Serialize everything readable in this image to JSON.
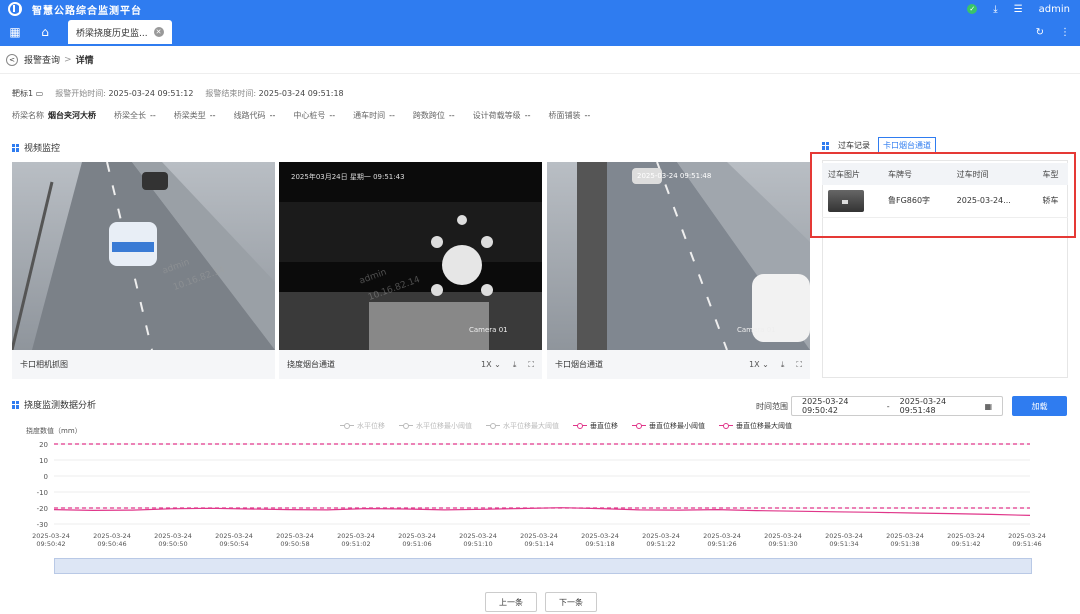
{
  "header": {
    "app_title": "智慧公路综合监测平台",
    "user": "admin"
  },
  "tabs": [
    {
      "label": "桥梁挠度历史监..."
    }
  ],
  "breadcrumb": {
    "parent": "报警查询",
    "sep": ">",
    "current": "详情"
  },
  "alarm": {
    "title": "靶标1",
    "start_label": "报警开始时间:",
    "start_value": "2025-03-24 09:51:12",
    "end_label": "报警结束时间:",
    "end_value": "2025-03-24 09:51:18"
  },
  "bridge_info": [
    {
      "label": "桥梁名称",
      "value": "烟台夹河大桥",
      "bold": true
    },
    {
      "label": "桥梁全长",
      "value": "--"
    },
    {
      "label": "桥梁类型",
      "value": "--"
    },
    {
      "label": "线路代码",
      "value": "--"
    },
    {
      "label": "中心桩号",
      "value": "--"
    },
    {
      "label": "通车时间",
      "value": "--"
    },
    {
      "label": "跨数跨位",
      "value": "--"
    },
    {
      "label": "设计荷载等级",
      "value": "--"
    },
    {
      "label": "桥面铺装",
      "value": "--"
    }
  ],
  "video_section": {
    "title": "视频监控"
  },
  "cameras": [
    {
      "label": "卡口相机抓图",
      "controls": false
    },
    {
      "label": "挠度烟台通道",
      "controls": true,
      "speed": "1X",
      "osd_time": "2025年03月24日 星期一 09:51:43",
      "osd_cam": "Camera 01"
    },
    {
      "label": "卡口烟台通道",
      "controls": true,
      "speed": "1X",
      "osd_time": "2025-03-24 09:51:48",
      "osd_cam": "Camera 01"
    }
  ],
  "records": {
    "tabs": [
      "过车记录",
      "卡口烟台通道"
    ],
    "active_tab": 1,
    "columns": [
      "过车图片",
      "车牌号",
      "过车时间",
      "车型"
    ],
    "rows": [
      {
        "plate": "鲁FG860字",
        "time": "2025-03-24...",
        "type": "轿车"
      }
    ]
  },
  "analysis": {
    "title": "挠度监测数据分析",
    "time_range_label": "时间范围",
    "time_start": "2025-03-24 09:50:42",
    "time_sep": "-",
    "time_end": "2025-03-24 09:51:48",
    "load_button": "加载"
  },
  "watermark": {
    "name": "admin",
    "ip": "10.16.82.14"
  },
  "chart_data": {
    "type": "line",
    "ylabel": "挠度数值（mm）",
    "ylim": [
      -30,
      20
    ],
    "yticks": [
      20,
      10,
      0,
      -10,
      -20,
      -30
    ],
    "legend": [
      {
        "name": "水平位移",
        "active": false
      },
      {
        "name": "水平位移最小阈值",
        "active": false
      },
      {
        "name": "水平位移最大阈值",
        "active": false
      },
      {
        "name": "垂直位移",
        "active": true
      },
      {
        "name": "垂直位移最小阈值",
        "active": true
      },
      {
        "name": "垂直位移最大阈值",
        "active": true
      }
    ],
    "x_ticks": [
      [
        "2025-03-24",
        "09:50:42"
      ],
      [
        "2025-03-24",
        "09:50:46"
      ],
      [
        "2025-03-24",
        "09:50:50"
      ],
      [
        "2025-03-24",
        "09:50:54"
      ],
      [
        "2025-03-24",
        "09:50:58"
      ],
      [
        "2025-03-24",
        "09:51:02"
      ],
      [
        "2025-03-24",
        "09:51:06"
      ],
      [
        "2025-03-24",
        "09:51:10"
      ],
      [
        "2025-03-24",
        "09:51:14"
      ],
      [
        "2025-03-24",
        "09:51:18"
      ],
      [
        "2025-03-24",
        "09:51:22"
      ],
      [
        "2025-03-24",
        "09:51:26"
      ],
      [
        "2025-03-24",
        "09:51:30"
      ],
      [
        "2025-03-24",
        "09:51:34"
      ],
      [
        "2025-03-24",
        "09:51:38"
      ],
      [
        "2025-03-24",
        "09:51:42"
      ],
      [
        "2025-03-24",
        "09:51:46"
      ]
    ],
    "series": [
      {
        "name": "垂直位移",
        "color": "#e0368a",
        "values": [
          -21,
          -21.5,
          -21.3,
          -20.5,
          -20.2,
          -20.6,
          -21,
          -21.2,
          -20.4,
          -20.6,
          -21.2,
          -20.8,
          -20.3,
          -19.8,
          -20.4,
          -21.2,
          -21.3,
          -21.0,
          -21.6,
          -22.0,
          -22.4,
          -22.7,
          -23.1,
          -23.5,
          -24.0,
          -24.6
        ]
      },
      {
        "name": "垂直位移最大阈值",
        "color": "#e0368a",
        "dashed": true,
        "constant": 20
      },
      {
        "name": "垂直位移最小阈值",
        "color": "#e0368a",
        "dashed": true,
        "constant": -20
      }
    ],
    "grid": true
  },
  "pager": {
    "prev": "上一条",
    "next": "下一条"
  }
}
